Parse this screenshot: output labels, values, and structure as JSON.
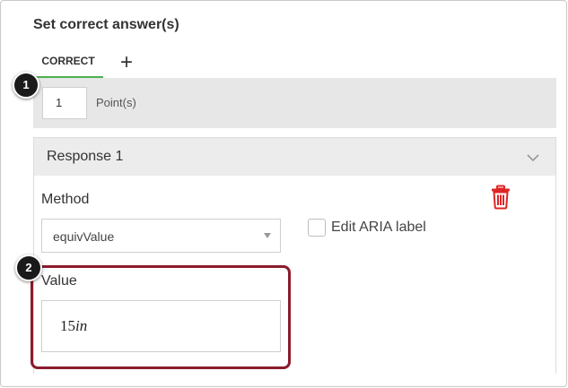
{
  "section_title": "Set correct answer(s)",
  "tabs": {
    "correct_label": "CORRECT",
    "add_label": "+"
  },
  "points": {
    "value": "1",
    "label": "Point(s)"
  },
  "response": {
    "title": "Response 1",
    "method_label": "Method",
    "method_selected": "equivValue",
    "edit_aria_label": "Edit ARIA label",
    "value_label": "Value",
    "value_number": "15",
    "value_unit": "in"
  },
  "callouts": [
    "1",
    "2"
  ],
  "colors": {
    "tab_underline": "#4caf50",
    "trash": "#e02424",
    "highlight_border": "#8b1c2c",
    "points_row_bg": "#e7e7e7",
    "response_header_bg": "#ececec"
  },
  "icons": {
    "add": "plus-icon",
    "collapse": "chevron-down-icon",
    "delete": "trash-icon",
    "select_caret": "caret-down-icon"
  }
}
